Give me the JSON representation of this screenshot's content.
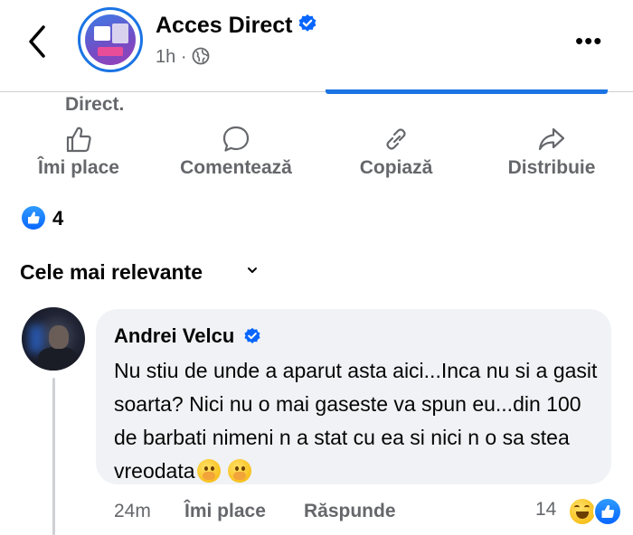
{
  "header": {
    "page_name": "Acces Direct",
    "time": "1h",
    "separator": "·",
    "more_label": "•••",
    "icons": {
      "back": "chevron-left-icon",
      "verified": "verified-badge-icon",
      "audience": "globe-icon",
      "more": "more-dots-icon"
    }
  },
  "post": {
    "caption_fragment": "Direct."
  },
  "actions": [
    {
      "label": "Îmi place",
      "icon": "thumbs-up-icon"
    },
    {
      "label": "Comentează",
      "icon": "comment-icon"
    },
    {
      "label": "Copiază",
      "icon": "link-icon"
    },
    {
      "label": "Distribuie",
      "icon": "share-icon"
    }
  ],
  "reactions": {
    "count": "4",
    "icon": "like-reaction-icon"
  },
  "sort": {
    "label": "Cele mai relevante",
    "icon": "chevron-down-icon"
  },
  "comment": {
    "author": "Andrei Velcu",
    "text": "Nu stiu de unde a aparut asta aici...Inca nu si a gasit soarta? Nici nu o mai gaseste va spun eu...din 100 de barbati nimeni n a stat cu ea si nici n o sa stea vreodata",
    "emojis": [
      "face-with-hand-over-mouth-emoji",
      "face-with-hand-over-mouth-emoji"
    ],
    "time": "24m",
    "like_label": "Îmi place",
    "reply_label": "Răspunde",
    "reaction_count": "14",
    "reaction_icons": [
      "laughing-reaction-icon",
      "like-reaction-icon"
    ]
  },
  "colors": {
    "accent": "#0866ff",
    "secondary_text": "#65676b",
    "bubble": "#f0f2f5"
  }
}
